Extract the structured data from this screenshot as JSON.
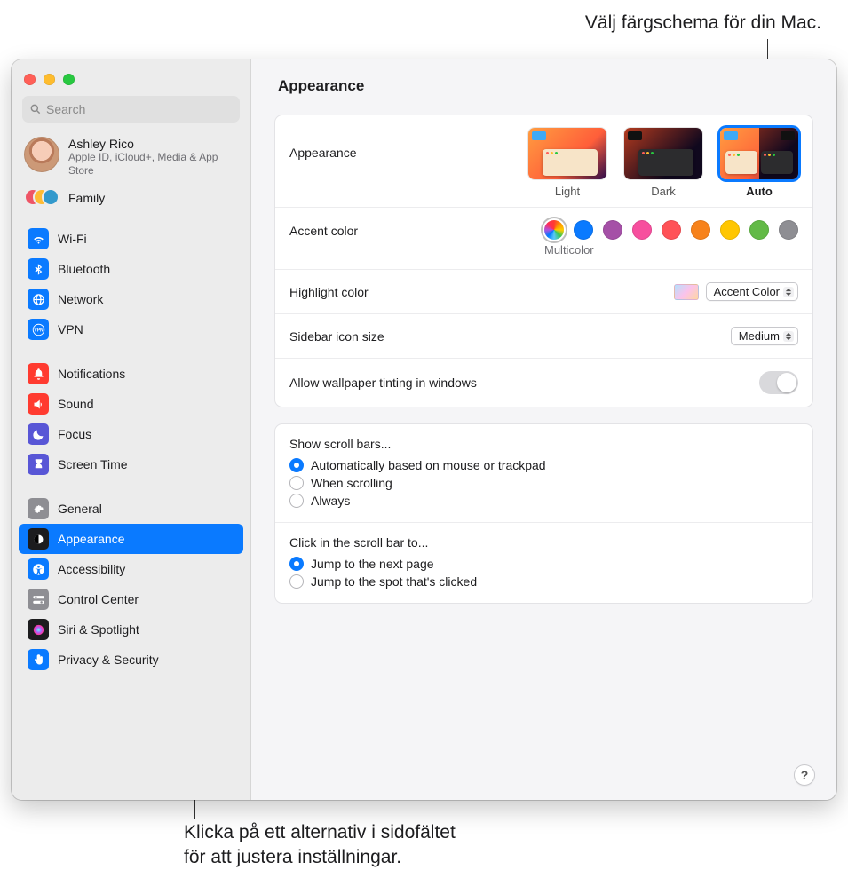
{
  "callouts": {
    "top": "Välj färgschema för din Mac.",
    "bottom_line1": "Klicka på ett alternativ i sidofältet",
    "bottom_line2": "för att justera inställningar."
  },
  "search": {
    "placeholder": "Search"
  },
  "account": {
    "name": "Ashley Rico",
    "subtitle": "Apple ID, iCloud+, Media & App Store"
  },
  "family": {
    "label": "Family"
  },
  "sidebar": {
    "groups": [
      {
        "items": [
          {
            "label": "Wi-Fi",
            "icon": "wifi-icon",
            "color": "#0a7aff"
          },
          {
            "label": "Bluetooth",
            "icon": "bluetooth-icon",
            "color": "#0a7aff"
          },
          {
            "label": "Network",
            "icon": "globe-icon",
            "color": "#0a7aff"
          },
          {
            "label": "VPN",
            "icon": "vpn-icon",
            "color": "#0a7aff"
          }
        ]
      },
      {
        "items": [
          {
            "label": "Notifications",
            "icon": "bell-icon",
            "color": "#ff3b30"
          },
          {
            "label": "Sound",
            "icon": "speaker-icon",
            "color": "#ff3b30"
          },
          {
            "label": "Focus",
            "icon": "moon-icon",
            "color": "#5856d6"
          },
          {
            "label": "Screen Time",
            "icon": "hourglass-icon",
            "color": "#5856d6"
          }
        ]
      },
      {
        "items": [
          {
            "label": "General",
            "icon": "gear-icon",
            "color": "#8e8e93"
          },
          {
            "label": "Appearance",
            "icon": "appearance-icon",
            "color": "#1c1c1e",
            "selected": true
          },
          {
            "label": "Accessibility",
            "icon": "accessibility-icon",
            "color": "#0a7aff"
          },
          {
            "label": "Control Center",
            "icon": "switches-icon",
            "color": "#8e8e93"
          },
          {
            "label": "Siri & Spotlight",
            "icon": "siri-icon",
            "color": "#1c1c1e"
          },
          {
            "label": "Privacy & Security",
            "icon": "hand-icon",
            "color": "#0a7aff"
          }
        ]
      }
    ]
  },
  "page": {
    "title": "Appearance"
  },
  "appearance": {
    "label": "Appearance",
    "options": [
      {
        "label": "Light",
        "selected": false
      },
      {
        "label": "Dark",
        "selected": false
      },
      {
        "label": "Auto",
        "selected": true
      }
    ]
  },
  "accent": {
    "label": "Accent color",
    "selected_name": "Multicolor",
    "colors": [
      {
        "key": "multicolor",
        "hex": "multicolor",
        "selected": true
      },
      {
        "key": "blue",
        "hex": "#0a7aff"
      },
      {
        "key": "purple",
        "hex": "#a550a7"
      },
      {
        "key": "pink",
        "hex": "#f74f9e"
      },
      {
        "key": "red",
        "hex": "#ff5257"
      },
      {
        "key": "orange",
        "hex": "#f7821b"
      },
      {
        "key": "yellow",
        "hex": "#ffc600"
      },
      {
        "key": "green",
        "hex": "#62ba46"
      },
      {
        "key": "gray",
        "hex": "#8e8e93"
      }
    ]
  },
  "highlight": {
    "label": "Highlight color",
    "value": "Accent Color"
  },
  "sidebar_size": {
    "label": "Sidebar icon size",
    "value": "Medium"
  },
  "tinting": {
    "label": "Allow wallpaper tinting in windows",
    "on": false
  },
  "scrollbars": {
    "label": "Show scroll bars...",
    "options": [
      {
        "label": "Automatically based on mouse or trackpad",
        "checked": true
      },
      {
        "label": "When scrolling",
        "checked": false
      },
      {
        "label": "Always",
        "checked": false
      }
    ]
  },
  "scrollclick": {
    "label": "Click in the scroll bar to...",
    "options": [
      {
        "label": "Jump to the next page",
        "checked": true
      },
      {
        "label": "Jump to the spot that's clicked",
        "checked": false
      }
    ]
  },
  "help": {
    "label": "?"
  }
}
